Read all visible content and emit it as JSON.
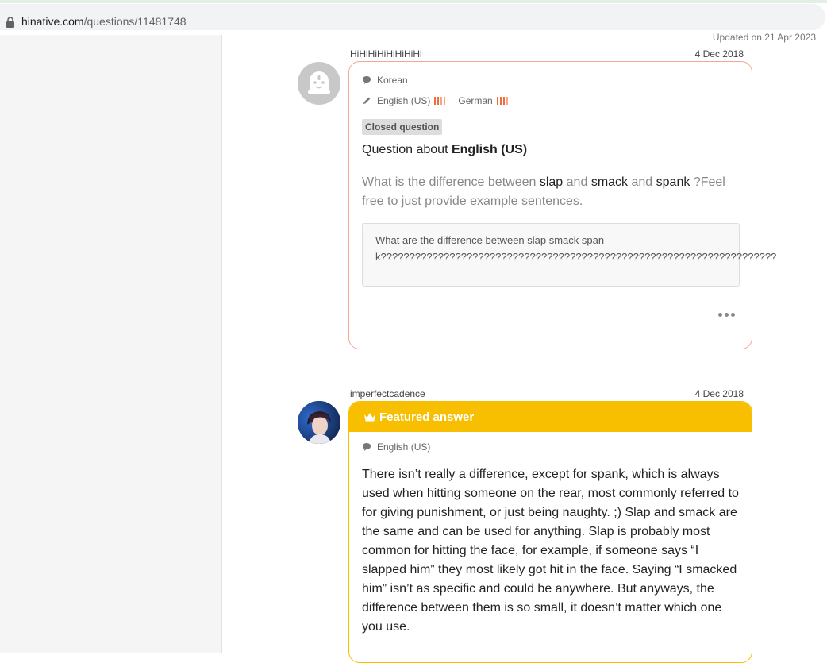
{
  "browser": {
    "url_domain": "hinative.com",
    "url_path": "/questions/11481748"
  },
  "page": {
    "updated": "Updated on 21 Apr 2023"
  },
  "question": {
    "username": "HiHiHiHiHiHiHiHi",
    "date": "4 Dec 2018",
    "native_language": "Korean",
    "learning": [
      {
        "language": "English (US)",
        "level_icon": "level-bars-icon"
      },
      {
        "language": "German",
        "level_icon": "level-bars-icon"
      }
    ],
    "status_badge": "Closed question",
    "about_prefix": "Question about",
    "about_language": "English (US)",
    "text_parts": [
      "What is the difference between",
      "slap",
      "and",
      "smack",
      "and",
      "spank",
      "?Feel free to just provide example sentences."
    ],
    "quote": "What are the difference between slap smack spank?????????????????????????????????????????????????????????????????????",
    "more_icon": "more-horizontal-icon",
    "accent": "#f3a796"
  },
  "answer": {
    "username": "imperfectcadence",
    "date": "4 Dec 2018",
    "featured_label": "Featured answer",
    "language": "English (US)",
    "text": "There isn’t really a difference, except for spank, which is always used when hitting someone on the rear, most commonly referred to for giving punishment, or just being naughty. ;) Slap and smack are the same and can be used for anything. Slap is probably most common for hitting the face, for example, if someone says “I slapped him” they most likely got hit in the face. Saying “I smacked him” isn’t as specific and could be anywhere. But anyways, the difference between them is so small, it doesn’t matter which one you use.",
    "accent": "#f7bf00"
  }
}
